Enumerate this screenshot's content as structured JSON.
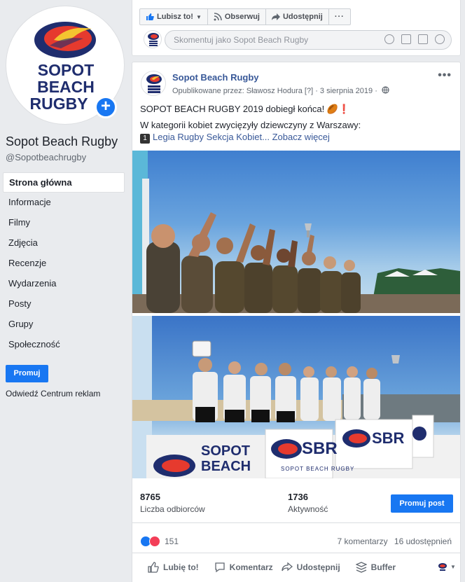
{
  "page": {
    "name": "Sopot Beach Rugby",
    "handle": "@Sopotbeachrugby",
    "logo_lines": [
      "SOPOT",
      "BEACH",
      "RUGBY"
    ]
  },
  "nav": [
    {
      "label": "Strona główna",
      "active": true
    },
    {
      "label": "Informacje"
    },
    {
      "label": "Filmy"
    },
    {
      "label": "Zdjęcia"
    },
    {
      "label": "Recenzje"
    },
    {
      "label": "Wydarzenia"
    },
    {
      "label": "Posty"
    },
    {
      "label": "Grupy"
    },
    {
      "label": "Społeczność"
    }
  ],
  "sidebar": {
    "promote_label": "Promuj",
    "ads_center_label": "Odwiedź Centrum reklam"
  },
  "toolbar": {
    "like_label": "Lubisz to!",
    "follow_label": "Obserwuj",
    "share_label": "Udostępnij",
    "more_label": "···"
  },
  "comment": {
    "placeholder": "Skomentuj jako Sopot Beach Rugby"
  },
  "post": {
    "author": "Sopot Beach Rugby",
    "meta": "Opublikowane przez: Sławosz Hodura [?] · 3 sierpnia 2019 ·",
    "text_line1": "SOPOT BEACH RUGBY 2019 dobiegł końca! 🏉❗",
    "text_line2": "W kategorii kobiet zwycięzyły dziewczyny z Warszawy:",
    "list_number": "1",
    "text_line3": "Legia Rugby Sekcja Kobiet...",
    "see_more": "Zobacz więcej",
    "dots": "•••"
  },
  "photos": {
    "banner_text": [
      "SOPOT",
      "BEACH"
    ],
    "sbr_label": "SBR",
    "sbr_sub": "SOPOT BEACH RUGBY"
  },
  "stats": {
    "reach_value": "8765",
    "reach_label": "Liczba odbiorców",
    "engagement_value": "1736",
    "engagement_label": "Aktywność",
    "promote_post_label": "Promuj post"
  },
  "reactions": {
    "count": "151",
    "comments": "7 komentarzy",
    "shares": "16 udostępnień"
  },
  "actions": {
    "like": "Lubię to!",
    "comment": "Komentarz",
    "share": "Udostępnij",
    "buffer": "Buffer"
  },
  "colors": {
    "facebook_blue": "#1877f2",
    "link_blue": "#385898",
    "logo_navy": "#1f2d6e",
    "logo_red": "#e63a2e",
    "logo_yellow": "#f4c430"
  }
}
